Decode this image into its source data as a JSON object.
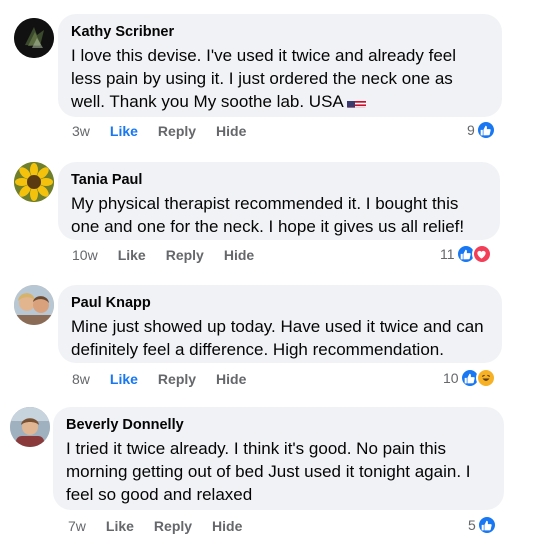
{
  "comments": [
    {
      "author": "Kathy Scribner",
      "text": "I love this devise. I've used it twice and already feel less pain by using it. I just ordered the neck one as well. Thank you My soothe lab. USA",
      "time": "3w",
      "like_label": "Like",
      "reply_label": "Reply",
      "hide_label": "Hide",
      "liked": true,
      "reaction_count": "9",
      "reactions": [
        "like"
      ],
      "has_flag": true
    },
    {
      "author": "Tania Paul",
      "text": "My physical therapist recommended it. I bought this one and one for the neck. I hope it gives us all relief!",
      "time": "10w",
      "like_label": "Like",
      "reply_label": "Reply",
      "hide_label": "Hide",
      "liked": false,
      "reaction_count": "11",
      "reactions": [
        "like",
        "love"
      ]
    },
    {
      "author": "Paul Knapp",
      "text": "Mine just showed up today. Have used it twice and can definitely feel a difference. High recommendation.",
      "time": "8w",
      "like_label": "Like",
      "reply_label": "Reply",
      "hide_label": "Hide",
      "liked": true,
      "reaction_count": "10",
      "reactions": [
        "like",
        "haha"
      ]
    },
    {
      "author": "Beverly Donnelly",
      "text": "I tried it twice already. I think it's good. No pain this morning getting out of bed Just used it tonight again. I feel so good and relaxed",
      "time": "7w",
      "like_label": "Like",
      "reply_label": "Reply",
      "hide_label": "Hide",
      "liked": false,
      "reaction_count": "5",
      "reactions": [
        "like"
      ]
    }
  ],
  "colors": {
    "bubble": "#f0f2f5",
    "link_blue": "#1877f2",
    "muted": "#65676b",
    "love": "#f33e58",
    "haha": "#f7b125"
  }
}
